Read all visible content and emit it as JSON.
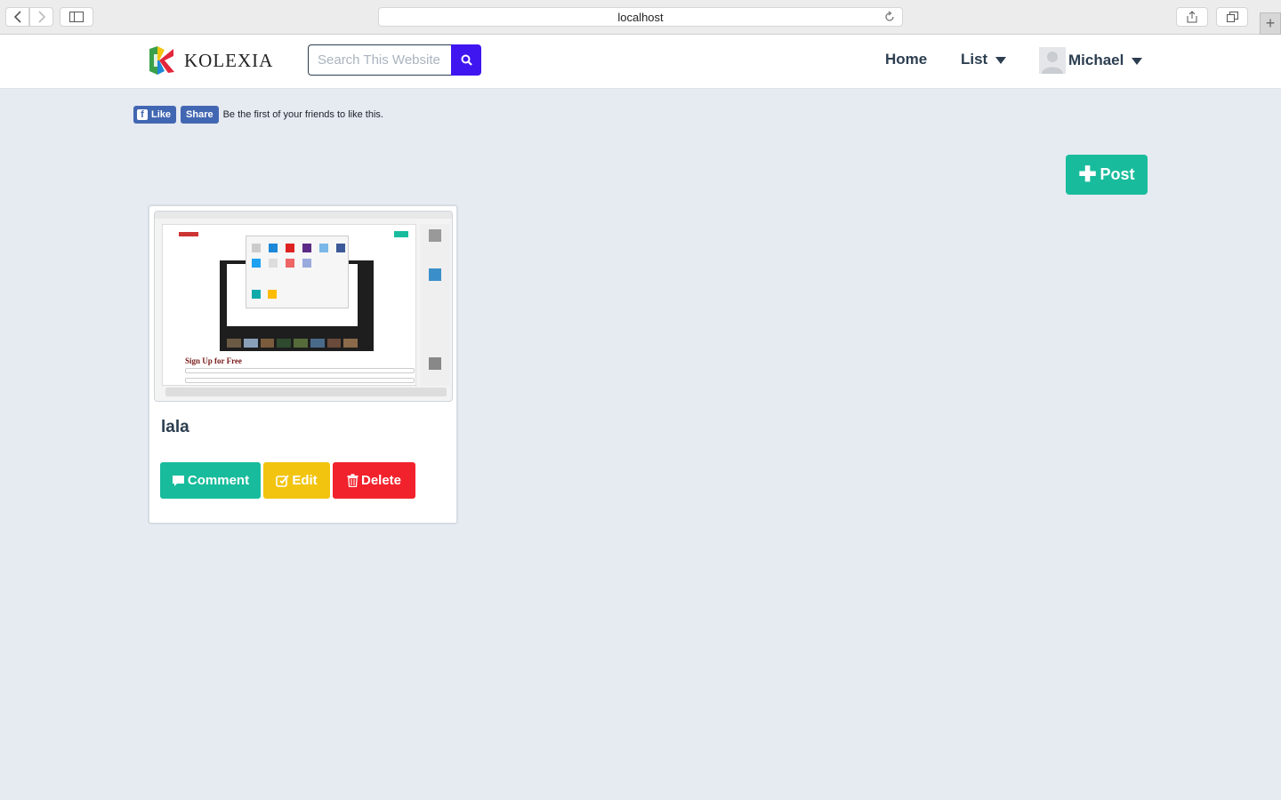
{
  "browser": {
    "address": "localhost"
  },
  "navbar": {
    "brand": "Kolexia",
    "search_placeholder": "Search This Website",
    "home": "Home",
    "list": "List",
    "user": "Michael"
  },
  "facebook": {
    "like": "Like",
    "share": "Share",
    "social_text": "Be the first of your friends to like this."
  },
  "post_button": "Post",
  "posts": [
    {
      "title": "lala",
      "thumbnail_caption": "Sign Up for Free",
      "actions": {
        "comment": "Comment",
        "edit": "Edit",
        "delete": "Delete"
      }
    }
  ],
  "colors": {
    "accent_green": "#18bc9c",
    "edit_yellow": "#f2c40f",
    "delete_red": "#f2222c",
    "search_blue": "#3f16f0",
    "page_bg": "#e6eaf1",
    "text_dark": "#2c3e50"
  }
}
